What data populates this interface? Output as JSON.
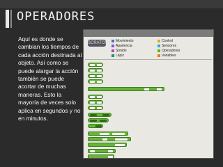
{
  "slide": {
    "title": "OPERADORES",
    "body": "Aquí es donde se cambian los tiempos de cada acción destinada al objeto. Así como se puede alargar la acción también se puede acortar de muchas maneras. Esto la mayoría de veces solo aplica en segundos y no en minutos."
  },
  "categories": [
    {
      "label": "Movimiento",
      "color": "#4a6cd4"
    },
    {
      "label": "Apariencia",
      "color": "#8a55d7"
    },
    {
      "label": "Sonido",
      "color": "#bb42c3"
    },
    {
      "label": "Lápiz",
      "color": "#0e9a6c"
    },
    {
      "label": "Control",
      "color": "#e1a91a"
    },
    {
      "label": "Sensores",
      "color": "#2ca5e2"
    },
    {
      "label": "Operadores",
      "color": "#5cb712"
    },
    {
      "label": "Variables",
      "color": "#ee7d16"
    }
  ],
  "colors": {
    "operators": "#67b43a",
    "background": "#2b2b2b",
    "text": "#f5f5f5"
  }
}
